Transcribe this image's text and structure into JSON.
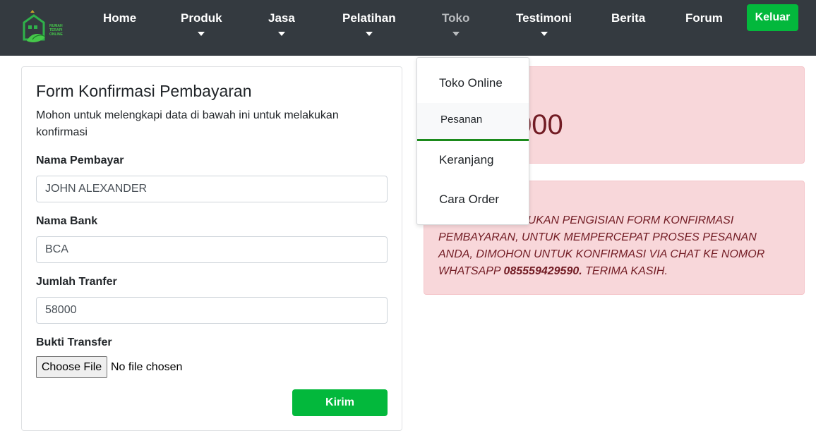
{
  "nav": {
    "logo_alt": "RUMAH TERAPI ONLINE",
    "items": [
      {
        "label": "Home",
        "has_caret": false
      },
      {
        "label": "Produk",
        "has_caret": true
      },
      {
        "label": "Jasa",
        "has_caret": true
      },
      {
        "label": "Pelatihan",
        "has_caret": true
      },
      {
        "label": "Toko",
        "has_caret": true,
        "state": "open"
      },
      {
        "label": "Testimoni",
        "has_caret": true
      },
      {
        "label": "Berita",
        "has_caret": false
      },
      {
        "label": "Forum",
        "has_caret": false
      }
    ],
    "logout_label": "Keluar"
  },
  "toko_dropdown": {
    "items": [
      {
        "label": "Toko Online"
      },
      {
        "label": "Pesanan",
        "active": true
      },
      {
        "label": "Keranjang"
      },
      {
        "label": "Cara Order"
      }
    ]
  },
  "form": {
    "title": "Form Konfirmasi Pembayaran",
    "description": "Mohon untuk melengkapi data di bawah ini untuk melakukan konfirmasi",
    "fields": [
      {
        "label": "Nama Pembayar",
        "value": "JOHN ALEXANDER"
      },
      {
        "label": "Nama Bank",
        "value": "BCA"
      },
      {
        "label": "Jumlah Tranfer",
        "value": "58000"
      }
    ],
    "file": {
      "label": "Bukti Transfer",
      "button_label": "Choose File",
      "status": "No file chosen"
    },
    "submit_label": "Kirim"
  },
  "total_alert": {
    "visible_amount": "000"
  },
  "note_alert": {
    "line1": "KUKAN PENGISIAN FORM KONFIRMASI",
    "line2": "PEMBAYARAN, UNTUK MEMPERCEPAT PROSES PESANAN",
    "line3": "ANDA, DIMOHON UNTUK KONFIRMASI VIA CHAT KE NOMOR",
    "line4_prefix": "WHATSAPP ",
    "phone": "085559429590.",
    "line4_suffix": " TERIMA KASIH."
  },
  "colors": {
    "navbar": "#343a40",
    "accent_green": "#03b83c",
    "alert_bg": "#f8d7da",
    "alert_text": "#721c24",
    "dropdown_active_border": "#1b8a1b"
  },
  "icons": {
    "logo": "house-leaf-logo-icon",
    "caret": "caret-down-icon"
  }
}
